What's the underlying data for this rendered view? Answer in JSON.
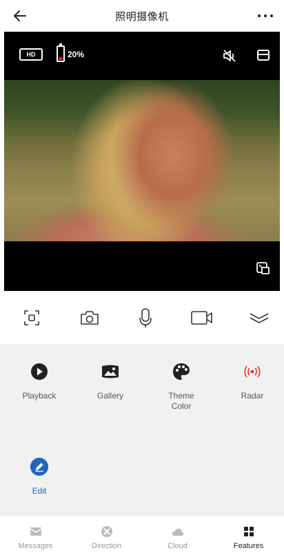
{
  "header": {
    "title": "照明摄像机"
  },
  "video": {
    "quality_badge": "HD",
    "battery_percent_text": "20%",
    "battery_level": 0.2
  },
  "controls": {
    "items": [
      "screenshot-frame",
      "snapshot",
      "microphone",
      "record-video",
      "collapse"
    ]
  },
  "features": [
    {
      "label": "Playback",
      "icon": "play-circle-icon"
    },
    {
      "label": "Gallery",
      "icon": "gallery-icon"
    },
    {
      "label": "Theme\nColor",
      "icon": "palette-icon"
    },
    {
      "label": "Radar",
      "icon": "radar-icon"
    },
    {
      "label": "Edit",
      "icon": "edit-icon"
    }
  ],
  "colors": {
    "radar": "#e8372f",
    "edit_accent": "#1e66c2",
    "battery_low": "#e02020"
  },
  "nav": {
    "tabs": [
      {
        "label": "Messages",
        "icon": "messages-icon"
      },
      {
        "label": "Direction",
        "icon": "direction-icon"
      },
      {
        "label": "Cloud",
        "icon": "cloud-icon"
      },
      {
        "label": "Features",
        "icon": "features-icon",
        "active": true
      }
    ]
  }
}
